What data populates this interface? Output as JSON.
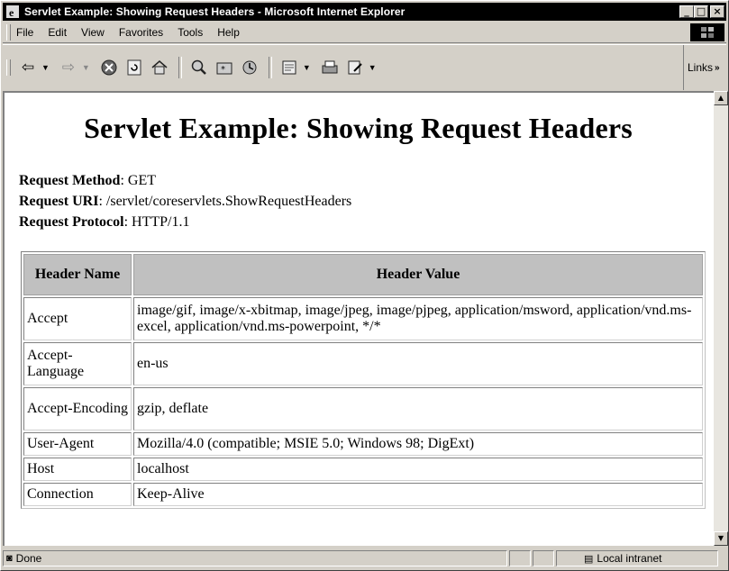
{
  "window": {
    "title": "Servlet Example: Showing Request Headers - Microsoft Internet Explorer",
    "buttons": {
      "minimize": "_",
      "maximize": "□",
      "close": "×"
    }
  },
  "menu": {
    "items": [
      {
        "label": "File",
        "icon": "menu"
      },
      {
        "label": "Edit",
        "icon": "menu"
      },
      {
        "label": "View",
        "icon": "menu"
      },
      {
        "label": "Favorites",
        "icon": "menu"
      },
      {
        "label": "Tools",
        "icon": "menu"
      },
      {
        "label": "Help",
        "icon": "menu"
      }
    ]
  },
  "toolbar": {
    "icons": [
      "back-icon",
      "forward-icon",
      "stop-icon",
      "refresh-icon",
      "home-icon",
      "search-icon",
      "favorites-icon",
      "history-icon",
      "mail-icon",
      "print-icon",
      "edit-icon"
    ],
    "links_label": "Links"
  },
  "page": {
    "heading": "Servlet Example: Showing Request Headers",
    "meta": [
      {
        "label": "Request Method",
        "value": ": GET"
      },
      {
        "label": "Request URI",
        "value": ": /servlet/coreservlets.ShowRequestHeaders"
      },
      {
        "label": "Request Protocol",
        "value": ": HTTP/1.1"
      }
    ],
    "table": {
      "headers": [
        "Header Name",
        "Header Value"
      ],
      "rows": [
        {
          "name": "Accept",
          "value": "image/gif, image/x-xbitmap, image/jpeg, image/pjpeg, application/msword, application/vnd.ms-excel, application/vnd.ms-powerpoint, */*"
        },
        {
          "name": "Accept-Language",
          "value": "en-us"
        },
        {
          "name": "Accept-Encoding",
          "value": "gzip, deflate"
        },
        {
          "name": "User-Agent",
          "value": "Mozilla/4.0 (compatible; MSIE 5.0; Windows 98; DigExt)"
        },
        {
          "name": "Host",
          "value": "localhost"
        },
        {
          "name": "Connection",
          "value": "Keep-Alive"
        }
      ]
    }
  },
  "status": {
    "text": "Done",
    "zone": "Local intranet"
  },
  "colors": {
    "titlebar": "#000000",
    "chrome": "#d4d0c8",
    "header_bg": "#c0c0c0"
  }
}
